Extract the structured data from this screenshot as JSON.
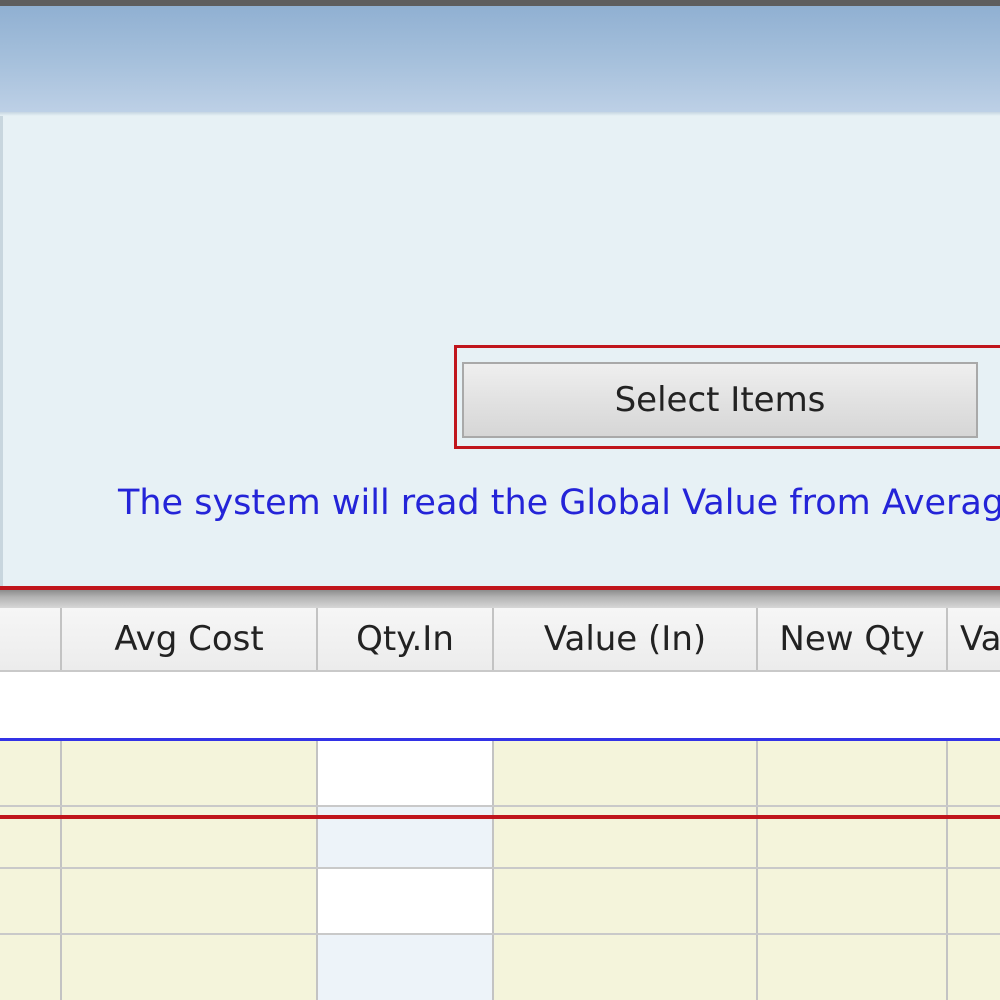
{
  "panel": {
    "select_button_label": "Select Items",
    "info_text": "The system will read the Global Value from Average"
  },
  "grid": {
    "columns": [
      "",
      "Avg Cost",
      "Qty.In",
      "Value (In)",
      "New Qty",
      "Va"
    ]
  },
  "colors": {
    "highlight": "#c0151c",
    "info_text": "#2424d8",
    "row_fill": "#f4f4db"
  }
}
